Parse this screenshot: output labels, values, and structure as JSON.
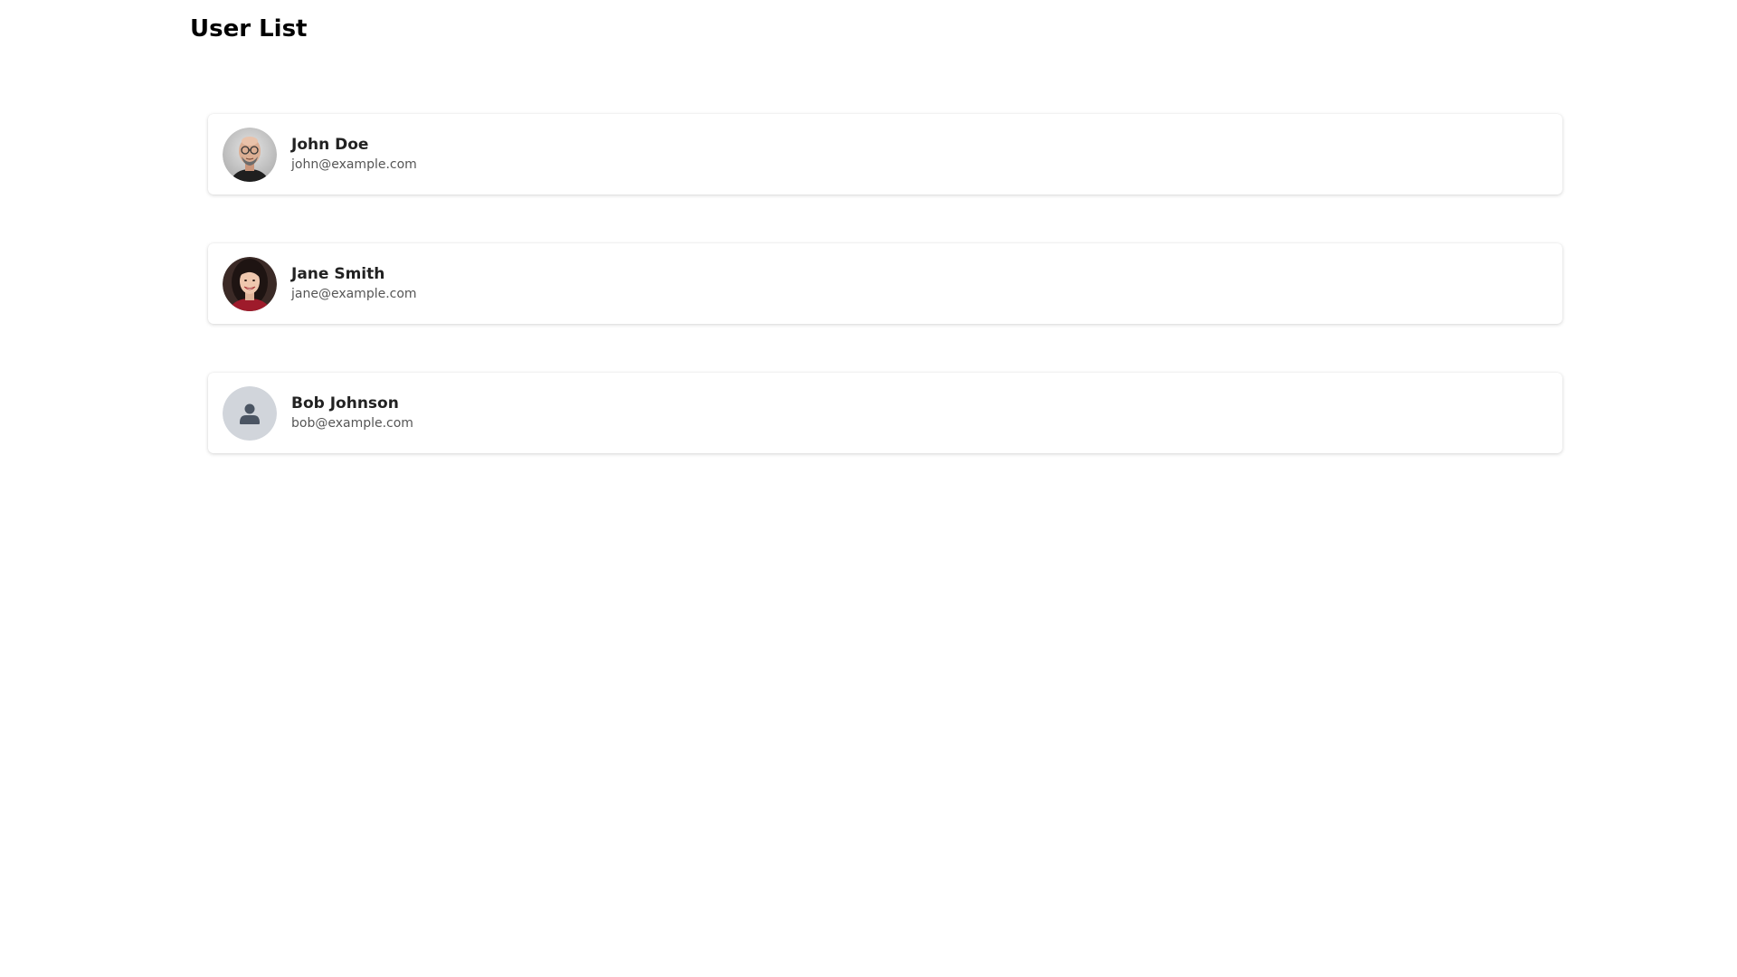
{
  "page": {
    "title": "User List"
  },
  "colors": {
    "card_background": "#ffffff",
    "name_text": "#222222",
    "email_text": "#555555",
    "placeholder_avatar_bg": "#d1d5db",
    "placeholder_avatar_fg": "#4b5563"
  },
  "users": [
    {
      "name": "John Doe",
      "email": "john@example.com",
      "avatar": "photo-avatar"
    },
    {
      "name": "Jane Smith",
      "email": "jane@example.com",
      "avatar": "photo-avatar"
    },
    {
      "name": "Bob Johnson",
      "email": "bob@example.com",
      "avatar": "user-icon"
    }
  ]
}
